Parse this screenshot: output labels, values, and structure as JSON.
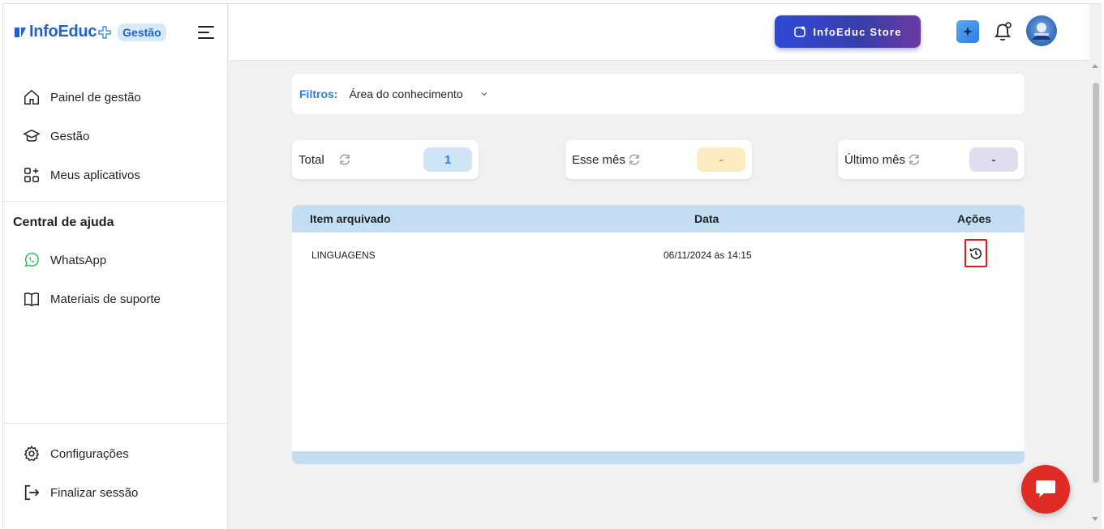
{
  "brand": {
    "name": "InfoEduc",
    "badge": "Gestão",
    "primary": "#1f63c8"
  },
  "sidebar": {
    "items": [
      {
        "label": "Painel de gestão",
        "icon": "home-icon"
      },
      {
        "label": "Gestão",
        "icon": "graduation-cap-icon"
      },
      {
        "label": "Meus aplicativos",
        "icon": "apps-grid-icon"
      }
    ],
    "help_title": "Central de ajuda",
    "help_items": [
      {
        "label": "WhatsApp",
        "icon": "whatsapp-icon"
      },
      {
        "label": "Materiais de suporte",
        "icon": "book-icon"
      }
    ],
    "bottom_items": [
      {
        "label": "Configurações",
        "icon": "gear-icon"
      },
      {
        "label": "Finalizar sessão",
        "icon": "logout-icon"
      }
    ]
  },
  "topbar": {
    "store_label": "InfoEduc Store"
  },
  "filters": {
    "label": "Filtros:",
    "area_select": "Área do conhecimento"
  },
  "stats": [
    {
      "label": "Total",
      "value": "1",
      "color": "#cfe4f7",
      "text_color": "#2a7ee0"
    },
    {
      "label": "Esse mês",
      "value": "-",
      "color": "#fdebc3",
      "text_color": "#e79a12"
    },
    {
      "label": "Último mês",
      "value": "-",
      "color": "#e2ddee",
      "text_color": "#4a3f72"
    }
  ],
  "table": {
    "headers": [
      "Item arquivado",
      "Data",
      "Ações"
    ],
    "rows": [
      {
        "item": "LINGUAGENS",
        "date": "06/11/2024 às 14:15",
        "action_icon": "restore-history-icon"
      }
    ]
  }
}
